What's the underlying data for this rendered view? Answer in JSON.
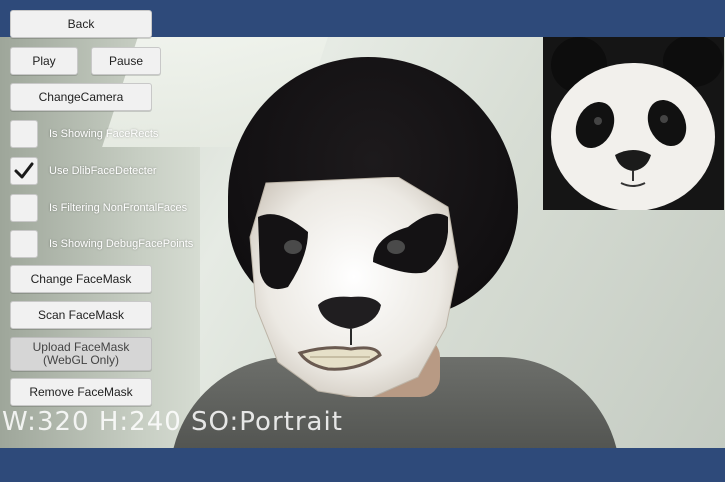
{
  "buttons": {
    "back": "Back",
    "play": "Play",
    "pause": "Pause",
    "change_camera": "ChangeCamera",
    "change_facemask": "Change FaceMask",
    "scan_facemask": "Scan FaceMask",
    "upload_facemask_line1": "Upload FaceMask",
    "upload_facemask_line2": "(WebGL Only)",
    "remove_facemask": "Remove FaceMask"
  },
  "toggles": [
    {
      "label": "Is Showing FaceRects",
      "checked": false
    },
    {
      "label": "Use DlibFaceDetecter",
      "checked": true
    },
    {
      "label": "Is Filtering NonFrontalFaces",
      "checked": false
    },
    {
      "label": "Is Showing DebugFacePoints",
      "checked": false
    }
  ],
  "camera": {
    "overlay_text": "W:320 H:240 SO:Portrait"
  },
  "colors": {
    "frame": "#2e4a7a",
    "button_bg": "#f1f1f1",
    "button_disabled_bg": "#d6d6d6"
  },
  "icons": {
    "check": "check-icon",
    "preview": "panda-face-preview",
    "mask": "panda-face-mask"
  }
}
